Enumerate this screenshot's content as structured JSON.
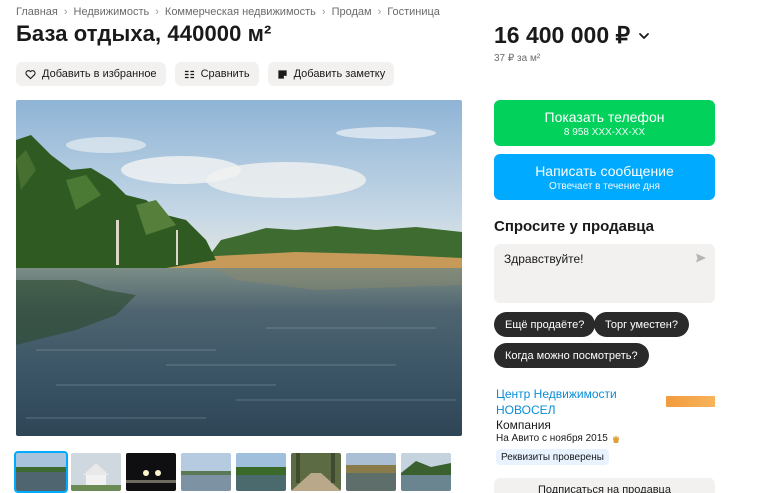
{
  "breadcrumb": [
    "Главная",
    "Недвижимость",
    "Коммерческая недвижимость",
    "Продам",
    "Гостиница"
  ],
  "title": "База отдыха, 440000 м²",
  "actions": {
    "favorite": "Добавить в избранное",
    "compare": "Сравнить",
    "note": "Добавить заметку"
  },
  "price": {
    "value": "16 400 000 ₽",
    "per_unit": "37 ₽ за м²"
  },
  "contact": {
    "phone_label": "Показать телефон",
    "phone_number": "8 958 XXX-XX-XX",
    "message_label": "Написать сообщение",
    "message_sub": "Отвечает в течение дня"
  },
  "ask": {
    "title": "Спросите у продавца",
    "input_value": "Здравствуйте!",
    "chips": [
      "Ещё продаёте?",
      "Торг уместен?",
      "Когда можно посмотреть?"
    ]
  },
  "seller": {
    "name_line1": "Центр Недвижимости",
    "name_line2": "НОВОСЕЛ",
    "type": "Компания",
    "since": "На Авито с ноября 2015",
    "verified": "Реквизиты проверены",
    "subscribe": "Подписаться на продавца"
  },
  "gallery": {
    "thumb_count": 8,
    "active_index": 0
  },
  "colors": {
    "green": "#02d15c",
    "blue": "#00aaff",
    "link": "#0a8ed6"
  }
}
